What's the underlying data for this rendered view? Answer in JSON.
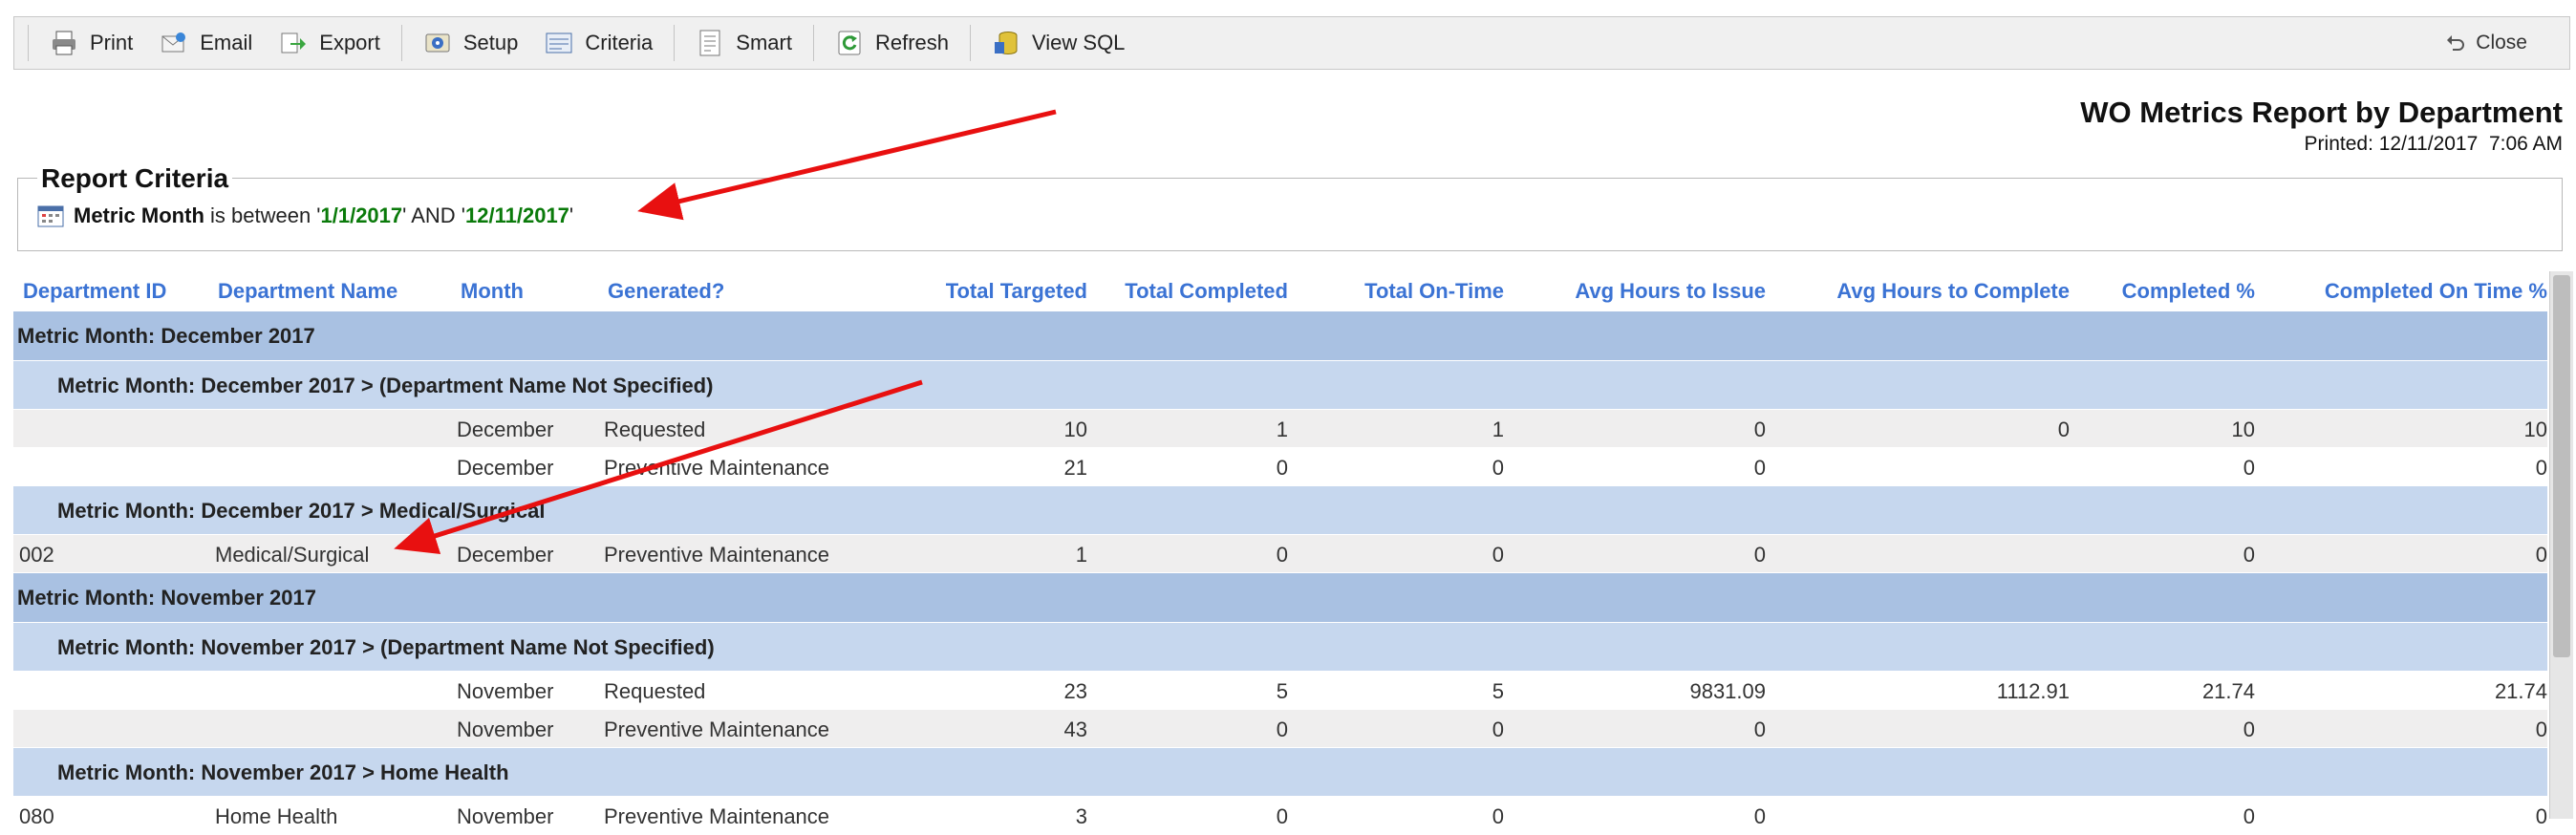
{
  "toolbar": {
    "print": "Print",
    "email": "Email",
    "export": "Export",
    "setup": "Setup",
    "criteria": "Criteria",
    "smart": "Smart",
    "refresh": "Refresh",
    "view_sql": "View SQL",
    "close": "Close"
  },
  "report": {
    "title": "WO Metrics Report by Department",
    "printed": "Printed: 12/11/2017  7:06 AM"
  },
  "criteria": {
    "legend": "Report Criteria",
    "field": "Metric Month",
    "op": " is between ",
    "q1": "'",
    "v1": "1/1/2017",
    "q2": "' AND '",
    "v2": "12/11/2017",
    "q3": "'"
  },
  "columns": {
    "dept_id": "Department ID",
    "dept_name": "Department Name",
    "month": "Month",
    "generated": "Generated?",
    "total_targeted": "Total Targeted",
    "total_completed": "Total Completed",
    "total_ontime": "Total On-Time",
    "avg_issue": "Avg Hours to Issue",
    "avg_complete": "Avg Hours to Complete",
    "completed_pct": "Completed %",
    "ontime_pct": "Completed On Time %"
  },
  "groups": {
    "dec": "Metric Month:  December 2017",
    "dec_nodept": "Metric Month:  December 2017 > (Department Name Not Specified)",
    "dec_medsurg": "Metric Month:  December 2017 > Medical/Surgical",
    "nov": "Metric Month:  November 2017",
    "nov_nodept": "Metric Month:  November 2017 > (Department Name Not Specified)",
    "nov_home": "Metric Month:  November 2017 > Home Health"
  },
  "rows": [
    {
      "id": "",
      "name": "",
      "month": "December",
      "gen": "Requested",
      "tt": "10",
      "tc": "1",
      "to": "1",
      "ai": "0",
      "ac": "0",
      "cp": "10",
      "op": "10"
    },
    {
      "id": "",
      "name": "",
      "month": "December",
      "gen": "Preventive Maintenance",
      "tt": "21",
      "tc": "0",
      "to": "0",
      "ai": "0",
      "ac": "",
      "cp": "0",
      "op": "0"
    },
    {
      "id": "002",
      "name": "Medical/Surgical",
      "month": "December",
      "gen": "Preventive Maintenance",
      "tt": "1",
      "tc": "0",
      "to": "0",
      "ai": "0",
      "ac": "",
      "cp": "0",
      "op": "0"
    },
    {
      "id": "",
      "name": "",
      "month": "November",
      "gen": "Requested",
      "tt": "23",
      "tc": "5",
      "to": "5",
      "ai": "9831.09",
      "ac": "1112.91",
      "cp": "21.74",
      "op": "21.74"
    },
    {
      "id": "",
      "name": "",
      "month": "November",
      "gen": "Preventive Maintenance",
      "tt": "43",
      "tc": "0",
      "to": "0",
      "ai": "0",
      "ac": "",
      "cp": "0",
      "op": "0"
    },
    {
      "id": "080",
      "name": "Home Health",
      "month": "November",
      "gen": "Preventive Maintenance",
      "tt": "3",
      "tc": "0",
      "to": "0",
      "ai": "0",
      "ac": "",
      "cp": "0",
      "op": "0"
    }
  ],
  "colors": {
    "header_text": "#3b73d4",
    "group1": "#a9c1e2",
    "group2": "#c6d7ee",
    "criteria_value": "#0a7a0a",
    "annotation_arrow": "#e81010"
  },
  "icons": [
    "printer-icon",
    "email-icon",
    "export-icon",
    "setup-icon",
    "criteria-icon",
    "smart-icon",
    "refresh-icon",
    "database-icon",
    "close-icon",
    "calendar-icon"
  ]
}
